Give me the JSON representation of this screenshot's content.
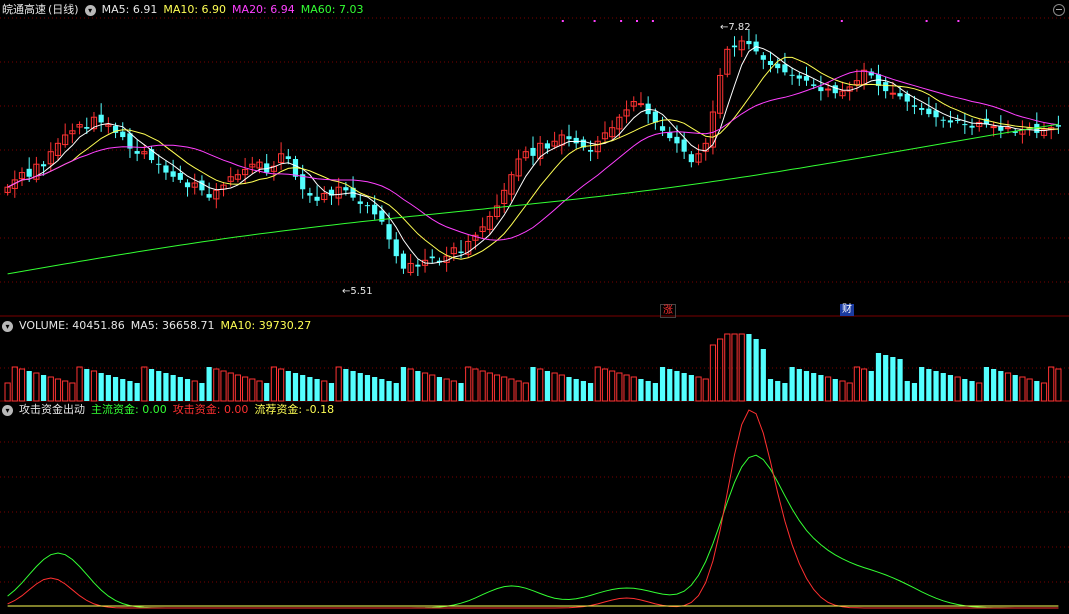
{
  "price_panel": {
    "stock_name": "皖通高速",
    "period": "(日线)",
    "ma5": {
      "label": "MA5:",
      "value": "6.91",
      "color": "#ffffff"
    },
    "ma10": {
      "label": "MA10:",
      "value": "6.90",
      "color": "#ffff54"
    },
    "ma20": {
      "label": "MA20:",
      "value": "6.94",
      "color": "#ff40ff"
    },
    "ma60": {
      "label": "MA60:",
      "value": "7.03",
      "color": "#33ff33"
    },
    "high_label": "7.82",
    "low_label": "5.51",
    "marker_zhang": "涨",
    "marker_cai": "财"
  },
  "volume_panel": {
    "title": "VOLUME:",
    "value": "40451.86",
    "ma5_label": "MA5:",
    "ma5_value": "36658.71",
    "ma10_label": "MA10:",
    "ma10_value": "39730.27"
  },
  "indicator_panel": {
    "title": "攻击资金出动",
    "main_label": "主流资金:",
    "main_value": "0.00",
    "attack_label": "攻击资金:",
    "attack_value": "0.00",
    "flow_label": "流荐资金:",
    "flow_value": "-0.18"
  },
  "colors": {
    "up": "#ff3333",
    "down": "#54ffff",
    "ma5": "#ffffff",
    "ma10": "#ffff54",
    "ma20": "#ff40ff",
    "ma60": "#33ff33",
    "grid": "#7a0000"
  },
  "chart_data": {
    "type": "candlestick",
    "price_range": [
      5.3,
      8.0
    ],
    "closes": [
      6.38,
      6.45,
      6.52,
      6.48,
      6.6,
      6.58,
      6.72,
      6.8,
      6.88,
      6.92,
      6.98,
      6.94,
      7.05,
      7.0,
      6.98,
      6.9,
      6.86,
      6.75,
      6.7,
      6.72,
      6.64,
      6.6,
      6.52,
      6.48,
      6.45,
      6.38,
      6.42,
      6.35,
      6.28,
      6.35,
      6.4,
      6.48,
      6.5,
      6.55,
      6.6,
      6.62,
      6.52,
      6.58,
      6.7,
      6.65,
      6.48,
      6.36,
      6.3,
      6.25,
      6.32,
      6.3,
      6.38,
      6.35,
      6.28,
      6.22,
      6.2,
      6.12,
      6.05,
      5.88,
      5.72,
      5.6,
      5.65,
      5.62,
      5.68,
      5.7,
      5.66,
      5.72,
      5.8,
      5.75,
      5.86,
      5.92,
      6.0,
      6.1,
      6.2,
      6.35,
      6.5,
      6.65,
      6.72,
      6.68,
      6.8,
      6.75,
      6.82,
      6.88,
      6.84,
      6.8,
      6.76,
      6.72,
      6.82,
      6.9,
      6.95,
      7.05,
      7.12,
      7.2,
      7.18,
      7.08,
      7.0,
      6.92,
      6.85,
      6.8,
      6.72,
      6.62,
      6.7,
      6.8,
      7.1,
      7.45,
      7.7,
      7.72,
      7.78,
      7.75,
      7.68,
      7.6,
      7.55,
      7.52,
      7.48,
      7.45,
      7.42,
      7.4,
      7.35,
      7.3,
      7.32,
      7.28,
      7.3,
      7.34,
      7.4,
      7.5,
      7.45,
      7.35,
      7.3,
      7.28,
      7.25,
      7.2,
      7.15,
      7.12,
      7.08,
      7.05,
      7.02,
      7.0,
      7.02,
      6.98,
      6.95,
      7.0,
      6.98,
      6.96,
      6.92,
      6.95,
      6.9,
      6.93,
      6.95,
      6.9,
      6.93,
      6.95,
      6.96
    ],
    "high_value": 7.82,
    "low_value": 5.51,
    "volume": {
      "value": 40451.86,
      "ma5": 36658.71,
      "ma10": 39730.27
    },
    "indicator": {
      "main": 0.0,
      "attack": 0.0,
      "flow": -0.18
    }
  }
}
